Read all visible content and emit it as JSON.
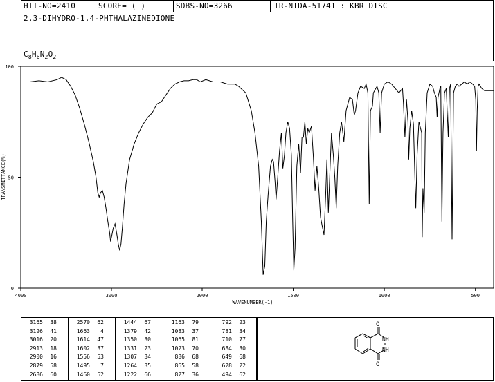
{
  "header": {
    "hit_no": "HIT-NO=2410",
    "score": "SCORE=  (   )",
    "sdbs_no": "SDBS-NO=3266",
    "ir_id": "IR-NIDA-51741 : KBR DISC",
    "compound_name": "2,3-DIHYDRO-1,4-PHTHALAZINEDIONE",
    "formula": {
      "c": "C",
      "c_n": "8",
      "h": "H",
      "h_n": "6",
      "n": "N",
      "n_n": "2",
      "o": "O",
      "o_n": "2"
    }
  },
  "chart_data": {
    "type": "line",
    "xlabel": "WAVENUMBER(-1)",
    "ylabel": "TRANSMITTANCE(%)",
    "xlim": [
      4000,
      400
    ],
    "ylim": [
      0,
      100
    ],
    "x_ticks": [
      4000,
      3000,
      2000,
      1500,
      1000,
      500
    ],
    "y_ticks": [
      0,
      50,
      100
    ],
    "grid": false,
    "series": [
      {
        "points": [
          [
            4000,
            93
          ],
          [
            3900,
            93
          ],
          [
            3800,
            93.5
          ],
          [
            3700,
            93
          ],
          [
            3600,
            94
          ],
          [
            3550,
            95
          ],
          [
            3500,
            94
          ],
          [
            3450,
            91
          ],
          [
            3400,
            87
          ],
          [
            3350,
            81
          ],
          [
            3300,
            74
          ],
          [
            3250,
            66
          ],
          [
            3200,
            57
          ],
          [
            3170,
            50
          ],
          [
            3150,
            43
          ],
          [
            3135,
            41
          ],
          [
            3120,
            43
          ],
          [
            3100,
            44
          ],
          [
            3080,
            41
          ],
          [
            3060,
            36
          ],
          [
            3040,
            30
          ],
          [
            3020,
            25
          ],
          [
            3010,
            21
          ],
          [
            2995,
            24
          ],
          [
            2980,
            27
          ],
          [
            2960,
            29
          ],
          [
            2940,
            24
          ],
          [
            2925,
            20
          ],
          [
            2910,
            17
          ],
          [
            2895,
            20
          ],
          [
            2880,
            27
          ],
          [
            2860,
            38
          ],
          [
            2840,
            47
          ],
          [
            2800,
            58
          ],
          [
            2750,
            65
          ],
          [
            2700,
            70
          ],
          [
            2650,
            74
          ],
          [
            2600,
            77
          ],
          [
            2550,
            79
          ],
          [
            2500,
            83
          ],
          [
            2450,
            84
          ],
          [
            2400,
            87
          ],
          [
            2350,
            90
          ],
          [
            2300,
            92
          ],
          [
            2250,
            93
          ],
          [
            2200,
            93.5
          ],
          [
            2150,
            93.5
          ],
          [
            2100,
            94
          ],
          [
            2060,
            94
          ],
          [
            2020,
            93
          ],
          [
            1980,
            94
          ],
          [
            1940,
            93
          ],
          [
            1900,
            93
          ],
          [
            1860,
            92
          ],
          [
            1820,
            92
          ],
          [
            1800,
            91
          ],
          [
            1760,
            88
          ],
          [
            1730,
            80
          ],
          [
            1710,
            70
          ],
          [
            1690,
            55
          ],
          [
            1675,
            30
          ],
          [
            1665,
            6
          ],
          [
            1656,
            10
          ],
          [
            1648,
            30
          ],
          [
            1638,
            42
          ],
          [
            1625,
            55
          ],
          [
            1615,
            58
          ],
          [
            1608,
            57
          ],
          [
            1600,
            48
          ],
          [
            1594,
            40
          ],
          [
            1585,
            50
          ],
          [
            1575,
            62
          ],
          [
            1565,
            70
          ],
          [
            1557,
            54
          ],
          [
            1548,
            60
          ],
          [
            1540,
            70
          ],
          [
            1530,
            75
          ],
          [
            1520,
            72
          ],
          [
            1510,
            60
          ],
          [
            1503,
            30
          ],
          [
            1497,
            8
          ],
          [
            1490,
            18
          ],
          [
            1480,
            55
          ],
          [
            1470,
            65
          ],
          [
            1460,
            52
          ],
          [
            1452,
            68
          ],
          [
            1444,
            68
          ],
          [
            1436,
            75
          ],
          [
            1428,
            65
          ],
          [
            1420,
            72
          ],
          [
            1412,
            70
          ],
          [
            1400,
            73
          ],
          [
            1390,
            60
          ],
          [
            1380,
            44
          ],
          [
            1370,
            55
          ],
          [
            1360,
            45
          ],
          [
            1350,
            32
          ],
          [
            1341,
            28
          ],
          [
            1331,
            24
          ],
          [
            1322,
            42
          ],
          [
            1315,
            58
          ],
          [
            1307,
            34
          ],
          [
            1300,
            50
          ],
          [
            1290,
            70
          ],
          [
            1280,
            60
          ],
          [
            1272,
            50
          ],
          [
            1264,
            36
          ],
          [
            1256,
            55
          ],
          [
            1245,
            70
          ],
          [
            1235,
            75
          ],
          [
            1222,
            66
          ],
          [
            1210,
            80
          ],
          [
            1190,
            86
          ],
          [
            1175,
            85
          ],
          [
            1165,
            78
          ],
          [
            1158,
            80
          ],
          [
            1145,
            88
          ],
          [
            1130,
            91
          ],
          [
            1110,
            90
          ],
          [
            1100,
            92
          ],
          [
            1090,
            88
          ],
          [
            1083,
            38
          ],
          [
            1076,
            80
          ],
          [
            1065,
            82
          ],
          [
            1060,
            88
          ],
          [
            1040,
            91
          ],
          [
            1030,
            88
          ],
          [
            1023,
            70
          ],
          [
            1015,
            88
          ],
          [
            1000,
            92
          ],
          [
            980,
            93
          ],
          [
            960,
            92
          ],
          [
            940,
            90
          ],
          [
            920,
            88
          ],
          [
            900,
            90
          ],
          [
            895,
            83
          ],
          [
            887,
            68
          ],
          [
            878,
            85
          ],
          [
            870,
            75
          ],
          [
            866,
            58
          ],
          [
            860,
            72
          ],
          [
            850,
            80
          ],
          [
            840,
            74
          ],
          [
            832,
            50
          ],
          [
            827,
            36
          ],
          [
            820,
            60
          ],
          [
            810,
            75
          ],
          [
            795,
            70
          ],
          [
            792,
            23
          ],
          [
            788,
            45
          ],
          [
            781,
            34
          ],
          [
            775,
            70
          ],
          [
            765,
            88
          ],
          [
            750,
            92
          ],
          [
            735,
            91
          ],
          [
            725,
            88
          ],
          [
            715,
            86
          ],
          [
            710,
            77
          ],
          [
            705,
            86
          ],
          [
            695,
            90
          ],
          [
            690,
            91
          ],
          [
            684,
            30
          ],
          [
            678,
            70
          ],
          [
            670,
            88
          ],
          [
            660,
            90
          ],
          [
            649,
            68
          ],
          [
            642,
            90
          ],
          [
            636,
            92
          ],
          [
            628,
            22
          ],
          [
            620,
            88
          ],
          [
            610,
            91
          ],
          [
            600,
            92
          ],
          [
            590,
            91
          ],
          [
            575,
            92
          ],
          [
            560,
            93
          ],
          [
            545,
            92
          ],
          [
            530,
            93
          ],
          [
            515,
            92
          ],
          [
            504,
            91
          ],
          [
            498,
            85
          ],
          [
            494,
            62
          ],
          [
            490,
            80
          ],
          [
            485,
            91
          ],
          [
            480,
            92
          ],
          [
            465,
            90
          ],
          [
            450,
            89
          ],
          [
            440,
            89
          ],
          [
            420,
            89
          ],
          [
            400,
            89
          ]
        ]
      }
    ]
  },
  "peak_table": {
    "columns": [
      [
        [
          "3165",
          "38"
        ],
        [
          "3126",
          "41"
        ],
        [
          "3016",
          "20"
        ],
        [
          "2913",
          "18"
        ],
        [
          "2900",
          "16"
        ],
        [
          "2879",
          "58"
        ],
        [
          "2686",
          "60"
        ]
      ],
      [
        [
          "2570",
          "62"
        ],
        [
          "1663",
          "4"
        ],
        [
          "1614",
          "47"
        ],
        [
          "1602",
          "37"
        ],
        [
          "1556",
          "53"
        ],
        [
          "1495",
          "7"
        ],
        [
          "1460",
          "52"
        ]
      ],
      [
        [
          "1444",
          "67"
        ],
        [
          "1379",
          "42"
        ],
        [
          "1350",
          "30"
        ],
        [
          "1331",
          "23"
        ],
        [
          "1307",
          "34"
        ],
        [
          "1264",
          "35"
        ],
        [
          "1222",
          "66"
        ]
      ],
      [
        [
          "1163",
          "79"
        ],
        [
          "1083",
          "37"
        ],
        [
          "1065",
          "81"
        ],
        [
          "1023",
          "70"
        ],
        [
          "886",
          "68"
        ],
        [
          "865",
          "58"
        ],
        [
          "827",
          "36"
        ]
      ],
      [
        [
          "792",
          "23"
        ],
        [
          "781",
          "34"
        ],
        [
          "710",
          "77"
        ],
        [
          "684",
          "30"
        ],
        [
          "649",
          "68"
        ],
        [
          "628",
          "22"
        ],
        [
          "494",
          "62"
        ]
      ]
    ]
  },
  "structure": {
    "atom_o_top": "O",
    "atom_o_bottom": "O",
    "atom_nh_top": "NH",
    "atom_nh_bottom": "NH"
  }
}
